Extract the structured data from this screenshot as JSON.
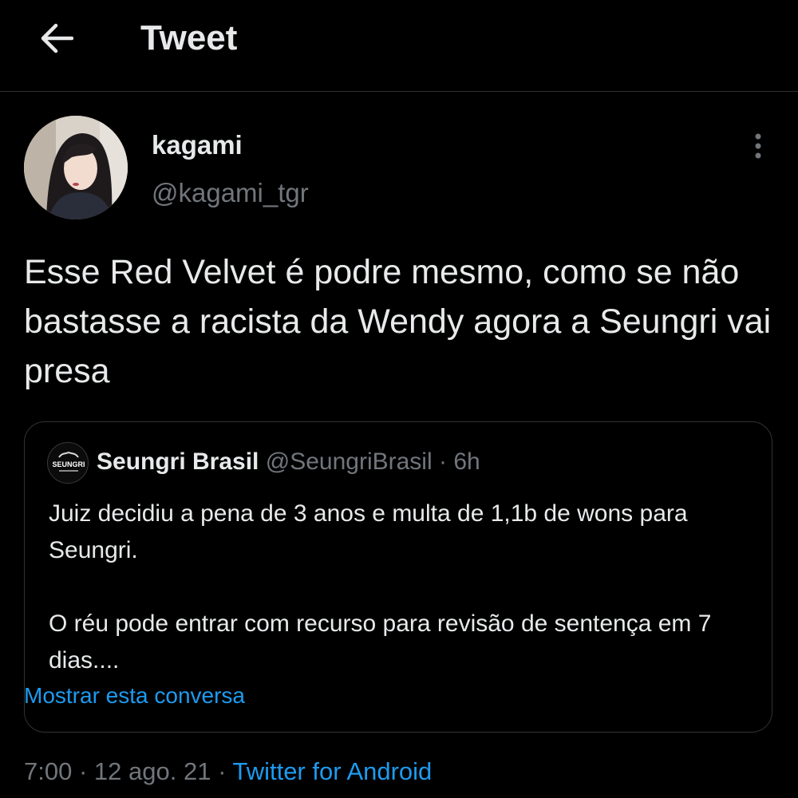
{
  "header": {
    "title": "Tweet",
    "back_icon": "arrow-left-icon"
  },
  "tweet": {
    "author_name": "kagami",
    "author_handle": "@kagami_tgr",
    "more_icon": "more-vertical-icon",
    "text": "Esse Red Velvet é podre mesmo, como se não bastasse a racista da Wendy agora a Seungri vai presa",
    "time": "7:00",
    "separator": "·",
    "date": "12 ago. 21",
    "source": "Twitter for Android"
  },
  "quote": {
    "avatar_text": "SEUNGRI",
    "name": "Seungri Brasil",
    "handle": "@SeungriBrasil",
    "separator": "·",
    "time": "6h",
    "paragraph_1": "Juiz decidiu a pena de 3 anos e multa de 1,1b de wons para Seungri.",
    "paragraph_2": "O réu pode entrar com recurso para revisão de sentença em 7 dias....",
    "show_conversation": "Mostrar esta conversa"
  },
  "colors": {
    "background": "#000000",
    "text_primary": "#e7e9ea",
    "text_secondary": "#71767b",
    "link": "#1d9bf0",
    "border": "#2f3336"
  }
}
